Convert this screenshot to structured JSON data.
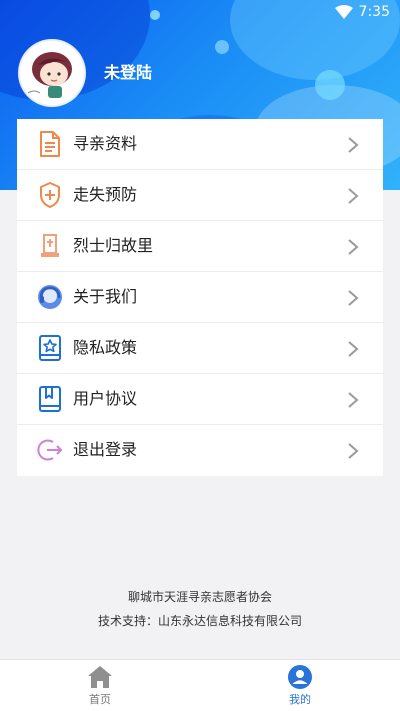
{
  "status_bar": {
    "time": "7:35"
  },
  "profile": {
    "username": "未登陆"
  },
  "menu": {
    "items": [
      {
        "label": "寻亲资料",
        "icon": "document-icon"
      },
      {
        "label": "走失预防",
        "icon": "shield-plus-icon"
      },
      {
        "label": "烈士归故里",
        "icon": "memorial-icon"
      },
      {
        "label": "关于我们",
        "icon": "headset-icon"
      },
      {
        "label": "隐私政策",
        "icon": "star-book-icon"
      },
      {
        "label": "用户协议",
        "icon": "bookmark-book-icon"
      },
      {
        "label": "退出登录",
        "icon": "logout-icon"
      }
    ]
  },
  "footer": {
    "organization": "聊城市天涯寻亲志愿者协会",
    "tech_support": "技术支持：山东永达信息科技有限公司"
  },
  "tabbar": {
    "tabs": [
      {
        "label": "首页",
        "icon": "home-icon",
        "active": false
      },
      {
        "label": "我的",
        "icon": "user-icon",
        "active": true
      }
    ]
  },
  "colors": {
    "header_gradient_start": "#0d5ef0",
    "header_gradient_end": "#31b2fb",
    "active_tab": "#2a73d8",
    "inactive_tab": "#777777"
  }
}
